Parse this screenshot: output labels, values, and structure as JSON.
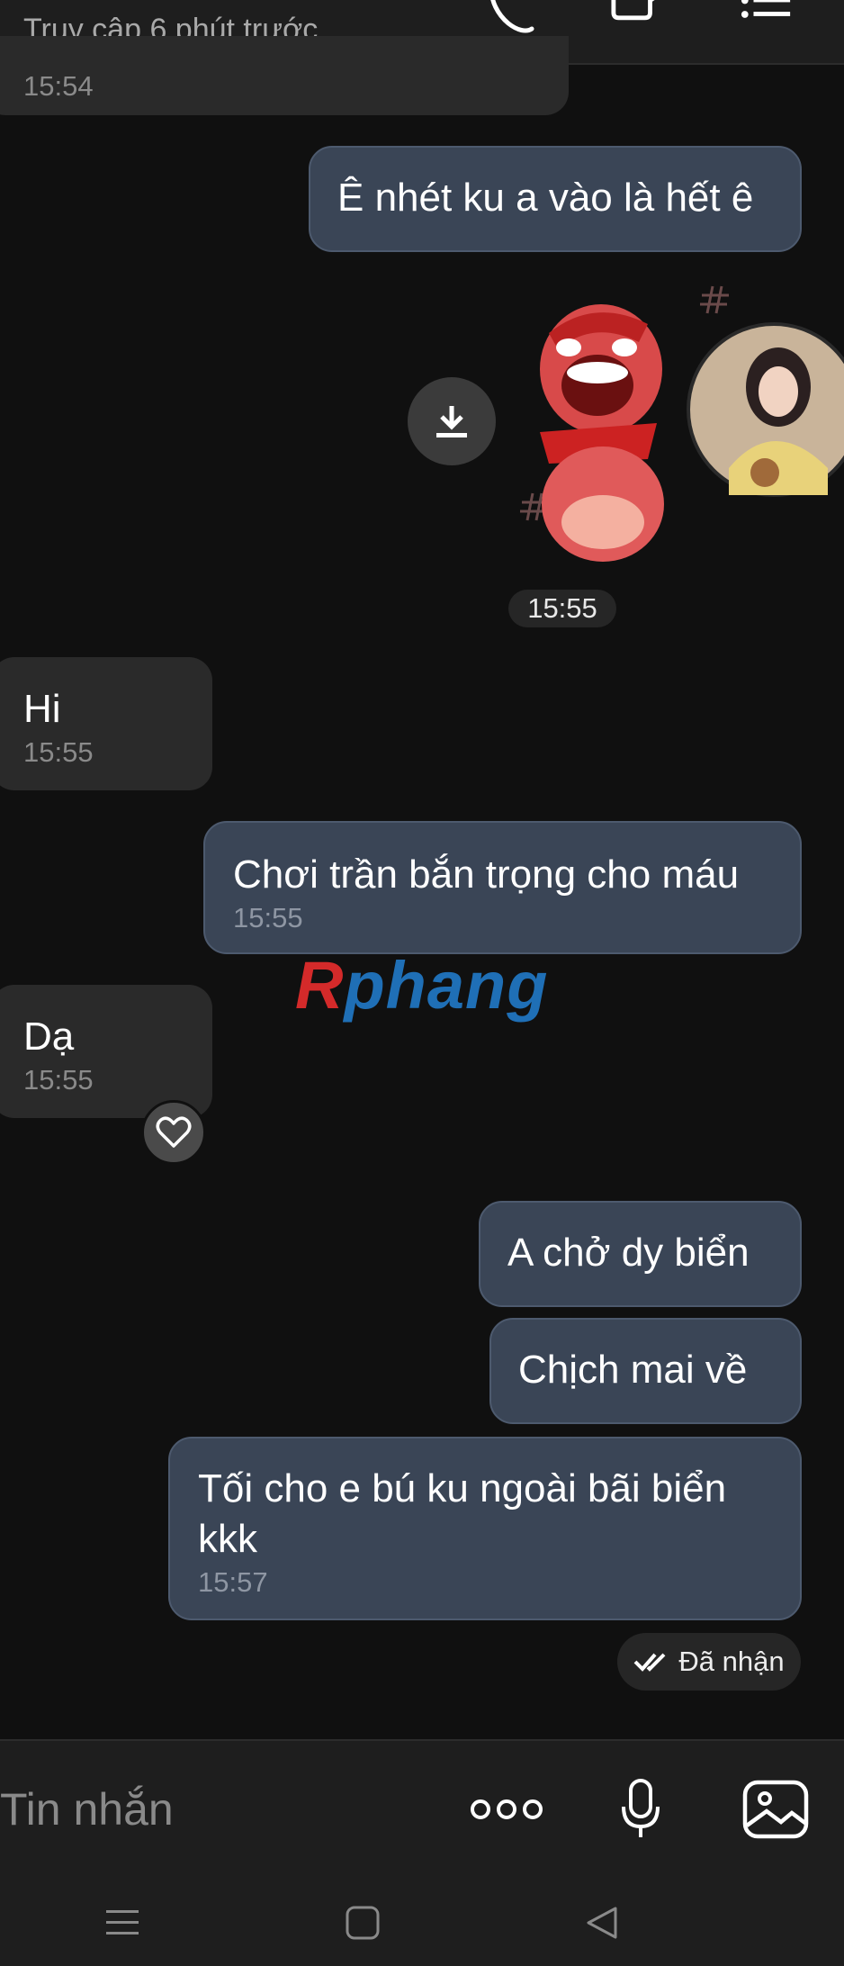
{
  "header": {
    "status": "Truy cập 6 phút trước"
  },
  "messages": {
    "partial_time": "15:54",
    "out1": "Ê nhét ku a vào là hết ê",
    "time_divider": "15:55",
    "in_hi": {
      "text": "Hi",
      "time": "15:55"
    },
    "out2": {
      "text": "Chơi trần bắn trọng cho máu",
      "time": "15:55"
    },
    "in_da": {
      "text": "Dạ",
      "time": "15:55"
    },
    "out3": "A chở dy biển",
    "out4": "Chịch mai về",
    "out5": {
      "text_line1": "Tối cho e bú ku ngoài bãi biển",
      "text_line2": "kkk",
      "time": "15:57"
    },
    "received_status": "Đã nhận"
  },
  "watermark": {
    "first": "R",
    "rest": "phang"
  },
  "composer": {
    "placeholder": "Tin nhắn"
  },
  "icons": {
    "header": [
      "phone-icon",
      "video-call-icon",
      "menu-list-icon"
    ],
    "composer": [
      "more-options-icon",
      "microphone-icon",
      "image-icon"
    ],
    "nav": [
      "recent-apps-icon",
      "home-icon",
      "back-icon"
    ]
  },
  "colors": {
    "background": "#101010",
    "incoming_bubble": "#2a2a2a",
    "outgoing_bubble": "#3a4556",
    "bars": "#1e1e1e"
  }
}
